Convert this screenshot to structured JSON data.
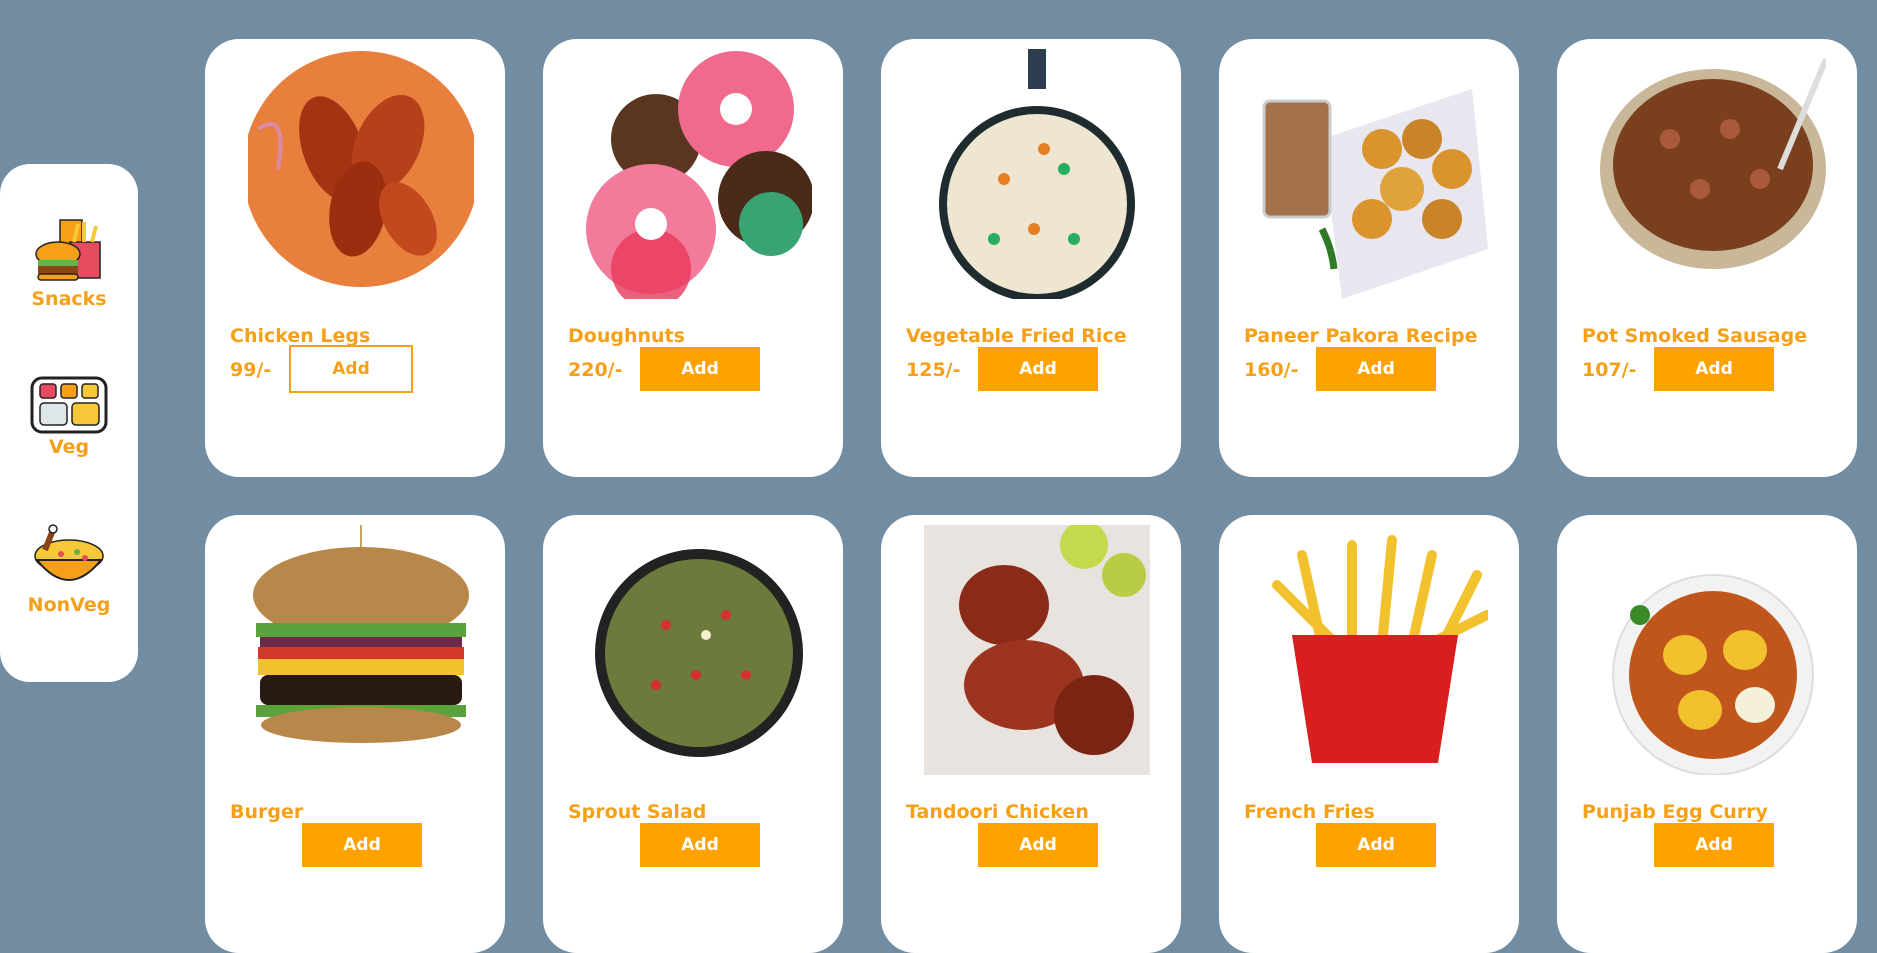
{
  "sidebar": {
    "categories": [
      {
        "label": "Snacks",
        "icon": "snacks-icon"
      },
      {
        "label": "Veg",
        "icon": "veg-thali-icon"
      },
      {
        "label": "NonVeg",
        "icon": "nonveg-icon"
      }
    ]
  },
  "colors": {
    "accent": "#ffa200",
    "text_accent": "#f6a019",
    "background": "#728da2"
  },
  "products": [
    {
      "name": "Chicken Legs",
      "price": "99/-",
      "button": "Add",
      "image": "chicken-legs-image"
    },
    {
      "name": "Doughnuts",
      "price": "220/-",
      "button": "Add",
      "image": "doughnuts-image"
    },
    {
      "name": "Vegetable Fried Rice",
      "price": "125/-",
      "button": "Add",
      "image": "fried-rice-image"
    },
    {
      "name": "Paneer Pakora Recipe",
      "price": "160/-",
      "button": "Add",
      "image": "paneer-pakora-image"
    },
    {
      "name": "Pot Smoked Sausage",
      "price": "107/-",
      "button": "Add",
      "image": "sausage-curry-image"
    },
    {
      "name": "Burger",
      "price": "",
      "button": "Add",
      "image": "burger-image"
    },
    {
      "name": "Sprout Salad",
      "price": "",
      "button": "Add",
      "image": "sprout-salad-image"
    },
    {
      "name": "Tandoori Chicken",
      "price": "",
      "button": "Add",
      "image": "tandoori-chicken-image"
    },
    {
      "name": "French Fries",
      "price": "",
      "button": "Add",
      "image": "french-fries-image"
    },
    {
      "name": "Punjab Egg Curry",
      "price": "",
      "button": "Add",
      "image": "egg-curry-image"
    }
  ]
}
